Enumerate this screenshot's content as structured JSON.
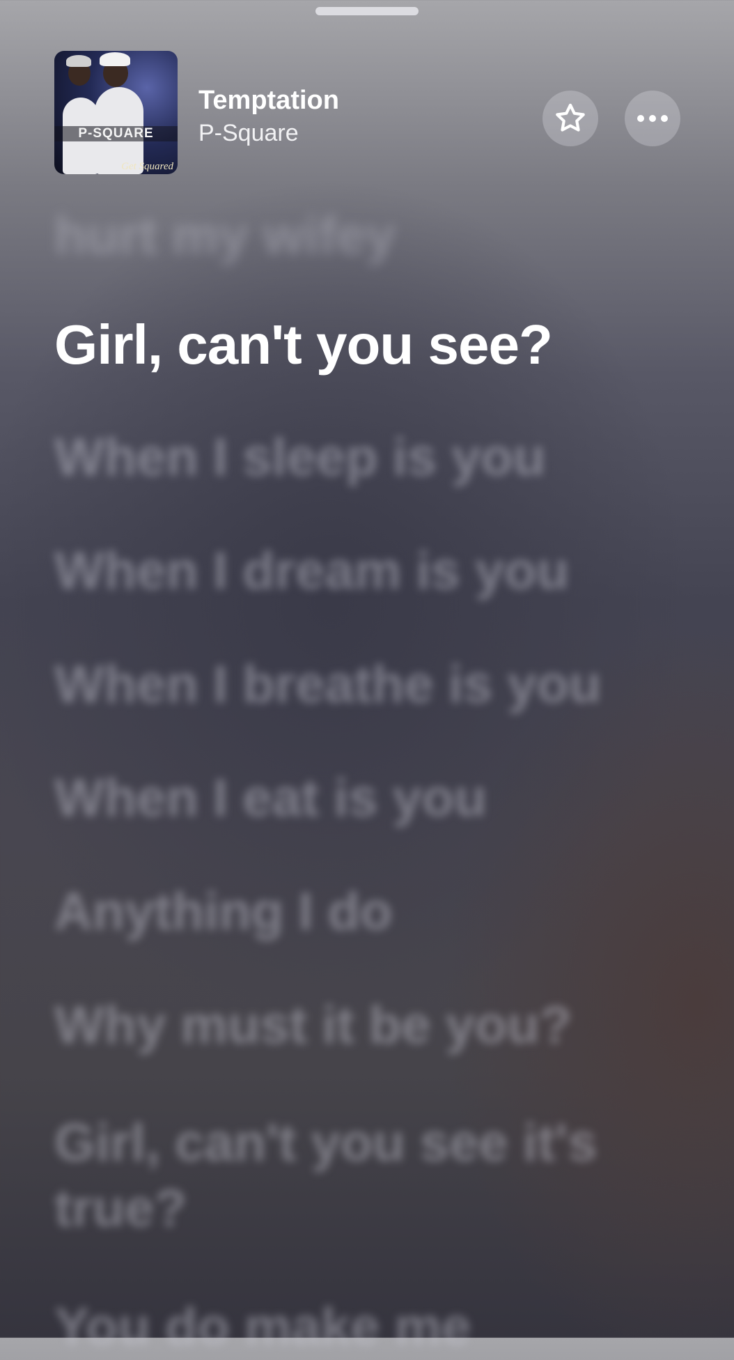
{
  "now_playing": {
    "title": "Temptation",
    "artist": "P-Square",
    "artwork": {
      "band_text": "P-SQUARE",
      "tagline": "Get Squared"
    }
  },
  "actions": {
    "favorite_icon": "star-icon",
    "more_icon": "ellipsis-icon"
  },
  "lyrics": {
    "previous": "hurt my wifey",
    "current": "Girl, can't you see?",
    "upcoming": [
      "When I sleep is you",
      "When I dream is you",
      "When I breathe is you",
      "When I eat is you",
      "Anything I do",
      "Why must it be you?",
      "Girl, can't you see it's true?",
      "You do make me"
    ]
  }
}
